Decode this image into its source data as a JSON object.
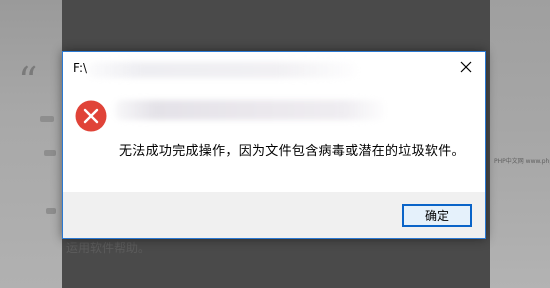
{
  "background": {
    "bottom_text": "运用软件帮助。",
    "right_text": "PHP中文网 www.php.cn"
  },
  "dialog": {
    "title": "F:\\",
    "message": "无法成功完成操作，因为文件包含病毒或潜在的垃圾软件。",
    "ok_label": "确定",
    "icon": "error-icon",
    "close_icon": "close-icon",
    "colors": {
      "error_red": "#e04338",
      "accent_border": "#2b79d2",
      "button_border": "#0a64c8",
      "footer_bg": "#f0f0f0"
    }
  }
}
